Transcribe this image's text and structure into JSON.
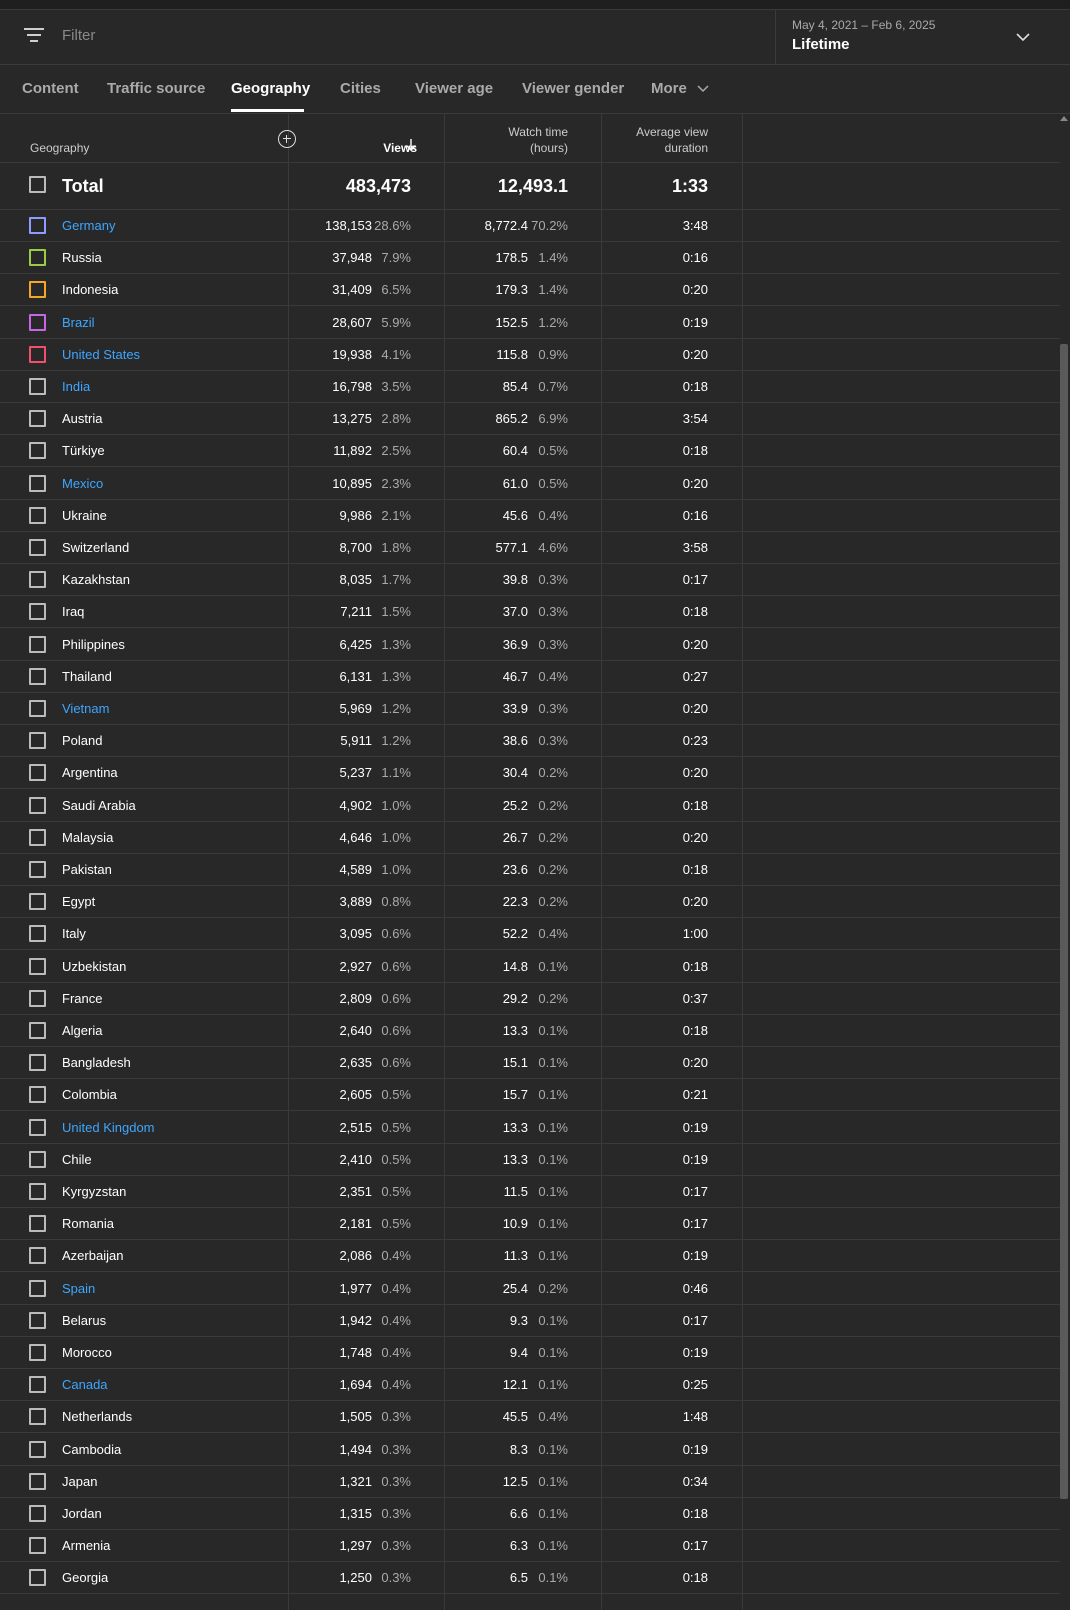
{
  "filter": {
    "placeholder": "Filter"
  },
  "date": {
    "range": "May 4, 2021 – Feb 6, 2025",
    "label": "Lifetime"
  },
  "tabs": [
    "Content",
    "Traffic source",
    "Geography",
    "Cities",
    "Viewer age",
    "Viewer gender",
    "More"
  ],
  "active_tab": "Geography",
  "table": {
    "headers": {
      "geography": "Geography",
      "views": "Views",
      "watch_time_1": "Watch time",
      "watch_time_2": "(hours)",
      "avd_1": "Average view",
      "avd_2": "duration"
    },
    "total": {
      "label": "Total",
      "views": "483,473",
      "watch": "12,493.1",
      "avd": "1:33"
    },
    "rows": [
      {
        "name": "Germany",
        "link": true,
        "swatch": "#8c9cff",
        "views": "138,153",
        "views_pct": "28.6%",
        "watch": "8,772.4",
        "watch_pct": "70.2%",
        "avd": "3:48"
      },
      {
        "name": "Russia",
        "link": false,
        "swatch": "#9ccc46",
        "views": "37,948",
        "views_pct": "7.9%",
        "watch": "178.5",
        "watch_pct": "1.4%",
        "avd": "0:16"
      },
      {
        "name": "Indonesia",
        "link": false,
        "swatch": "#f5a623",
        "views": "31,409",
        "views_pct": "6.5%",
        "watch": "179.3",
        "watch_pct": "1.4%",
        "avd": "0:20"
      },
      {
        "name": "Brazil",
        "link": true,
        "swatch": "#c666e5",
        "views": "28,607",
        "views_pct": "5.9%",
        "watch": "152.5",
        "watch_pct": "1.2%",
        "avd": "0:19"
      },
      {
        "name": "United States",
        "link": true,
        "swatch": "#f0506e",
        "views": "19,938",
        "views_pct": "4.1%",
        "watch": "115.8",
        "watch_pct": "0.9%",
        "avd": "0:20"
      },
      {
        "name": "India",
        "link": true,
        "swatch": "",
        "views": "16,798",
        "views_pct": "3.5%",
        "watch": "85.4",
        "watch_pct": "0.7%",
        "avd": "0:18"
      },
      {
        "name": "Austria",
        "link": false,
        "swatch": "",
        "views": "13,275",
        "views_pct": "2.8%",
        "watch": "865.2",
        "watch_pct": "6.9%",
        "avd": "3:54"
      },
      {
        "name": "Türkiye",
        "link": false,
        "swatch": "",
        "views": "11,892",
        "views_pct": "2.5%",
        "watch": "60.4",
        "watch_pct": "0.5%",
        "avd": "0:18"
      },
      {
        "name": "Mexico",
        "link": true,
        "swatch": "",
        "views": "10,895",
        "views_pct": "2.3%",
        "watch": "61.0",
        "watch_pct": "0.5%",
        "avd": "0:20"
      },
      {
        "name": "Ukraine",
        "link": false,
        "swatch": "",
        "views": "9,986",
        "views_pct": "2.1%",
        "watch": "45.6",
        "watch_pct": "0.4%",
        "avd": "0:16"
      },
      {
        "name": "Switzerland",
        "link": false,
        "swatch": "",
        "views": "8,700",
        "views_pct": "1.8%",
        "watch": "577.1",
        "watch_pct": "4.6%",
        "avd": "3:58"
      },
      {
        "name": "Kazakhstan",
        "link": false,
        "swatch": "",
        "views": "8,035",
        "views_pct": "1.7%",
        "watch": "39.8",
        "watch_pct": "0.3%",
        "avd": "0:17"
      },
      {
        "name": "Iraq",
        "link": false,
        "swatch": "",
        "views": "7,211",
        "views_pct": "1.5%",
        "watch": "37.0",
        "watch_pct": "0.3%",
        "avd": "0:18"
      },
      {
        "name": "Philippines",
        "link": false,
        "swatch": "",
        "views": "6,425",
        "views_pct": "1.3%",
        "watch": "36.9",
        "watch_pct": "0.3%",
        "avd": "0:20"
      },
      {
        "name": "Thailand",
        "link": false,
        "swatch": "",
        "views": "6,131",
        "views_pct": "1.3%",
        "watch": "46.7",
        "watch_pct": "0.4%",
        "avd": "0:27"
      },
      {
        "name": "Vietnam",
        "link": true,
        "swatch": "",
        "views": "5,969",
        "views_pct": "1.2%",
        "watch": "33.9",
        "watch_pct": "0.3%",
        "avd": "0:20"
      },
      {
        "name": "Poland",
        "link": false,
        "swatch": "",
        "views": "5,911",
        "views_pct": "1.2%",
        "watch": "38.6",
        "watch_pct": "0.3%",
        "avd": "0:23"
      },
      {
        "name": "Argentina",
        "link": false,
        "swatch": "",
        "views": "5,237",
        "views_pct": "1.1%",
        "watch": "30.4",
        "watch_pct": "0.2%",
        "avd": "0:20"
      },
      {
        "name": "Saudi Arabia",
        "link": false,
        "swatch": "",
        "views": "4,902",
        "views_pct": "1.0%",
        "watch": "25.2",
        "watch_pct": "0.2%",
        "avd": "0:18"
      },
      {
        "name": "Malaysia",
        "link": false,
        "swatch": "",
        "views": "4,646",
        "views_pct": "1.0%",
        "watch": "26.7",
        "watch_pct": "0.2%",
        "avd": "0:20"
      },
      {
        "name": "Pakistan",
        "link": false,
        "swatch": "",
        "views": "4,589",
        "views_pct": "1.0%",
        "watch": "23.6",
        "watch_pct": "0.2%",
        "avd": "0:18"
      },
      {
        "name": "Egypt",
        "link": false,
        "swatch": "",
        "views": "3,889",
        "views_pct": "0.8%",
        "watch": "22.3",
        "watch_pct": "0.2%",
        "avd": "0:20"
      },
      {
        "name": "Italy",
        "link": false,
        "swatch": "",
        "views": "3,095",
        "views_pct": "0.6%",
        "watch": "52.2",
        "watch_pct": "0.4%",
        "avd": "1:00"
      },
      {
        "name": "Uzbekistan",
        "link": false,
        "swatch": "",
        "views": "2,927",
        "views_pct": "0.6%",
        "watch": "14.8",
        "watch_pct": "0.1%",
        "avd": "0:18"
      },
      {
        "name": "France",
        "link": false,
        "swatch": "",
        "views": "2,809",
        "views_pct": "0.6%",
        "watch": "29.2",
        "watch_pct": "0.2%",
        "avd": "0:37"
      },
      {
        "name": "Algeria",
        "link": false,
        "swatch": "",
        "views": "2,640",
        "views_pct": "0.6%",
        "watch": "13.3",
        "watch_pct": "0.1%",
        "avd": "0:18"
      },
      {
        "name": "Bangladesh",
        "link": false,
        "swatch": "",
        "views": "2,635",
        "views_pct": "0.6%",
        "watch": "15.1",
        "watch_pct": "0.1%",
        "avd": "0:20"
      },
      {
        "name": "Colombia",
        "link": false,
        "swatch": "",
        "views": "2,605",
        "views_pct": "0.5%",
        "watch": "15.7",
        "watch_pct": "0.1%",
        "avd": "0:21"
      },
      {
        "name": "United Kingdom",
        "link": true,
        "swatch": "",
        "views": "2,515",
        "views_pct": "0.5%",
        "watch": "13.3",
        "watch_pct": "0.1%",
        "avd": "0:19"
      },
      {
        "name": "Chile",
        "link": false,
        "swatch": "",
        "views": "2,410",
        "views_pct": "0.5%",
        "watch": "13.3",
        "watch_pct": "0.1%",
        "avd": "0:19"
      },
      {
        "name": "Kyrgyzstan",
        "link": false,
        "swatch": "",
        "views": "2,351",
        "views_pct": "0.5%",
        "watch": "11.5",
        "watch_pct": "0.1%",
        "avd": "0:17"
      },
      {
        "name": "Romania",
        "link": false,
        "swatch": "",
        "views": "2,181",
        "views_pct": "0.5%",
        "watch": "10.9",
        "watch_pct": "0.1%",
        "avd": "0:17"
      },
      {
        "name": "Azerbaijan",
        "link": false,
        "swatch": "",
        "views": "2,086",
        "views_pct": "0.4%",
        "watch": "11.3",
        "watch_pct": "0.1%",
        "avd": "0:19"
      },
      {
        "name": "Spain",
        "link": true,
        "swatch": "",
        "views": "1,977",
        "views_pct": "0.4%",
        "watch": "25.4",
        "watch_pct": "0.2%",
        "avd": "0:46"
      },
      {
        "name": "Belarus",
        "link": false,
        "swatch": "",
        "views": "1,942",
        "views_pct": "0.4%",
        "watch": "9.3",
        "watch_pct": "0.1%",
        "avd": "0:17"
      },
      {
        "name": "Morocco",
        "link": false,
        "swatch": "",
        "views": "1,748",
        "views_pct": "0.4%",
        "watch": "9.4",
        "watch_pct": "0.1%",
        "avd": "0:19"
      },
      {
        "name": "Canada",
        "link": true,
        "swatch": "",
        "views": "1,694",
        "views_pct": "0.4%",
        "watch": "12.1",
        "watch_pct": "0.1%",
        "avd": "0:25"
      },
      {
        "name": "Netherlands",
        "link": false,
        "swatch": "",
        "views": "1,505",
        "views_pct": "0.3%",
        "watch": "45.5",
        "watch_pct": "0.4%",
        "avd": "1:48"
      },
      {
        "name": "Cambodia",
        "link": false,
        "swatch": "",
        "views": "1,494",
        "views_pct": "0.3%",
        "watch": "8.3",
        "watch_pct": "0.1%",
        "avd": "0:19"
      },
      {
        "name": "Japan",
        "link": false,
        "swatch": "",
        "views": "1,321",
        "views_pct": "0.3%",
        "watch": "12.5",
        "watch_pct": "0.1%",
        "avd": "0:34"
      },
      {
        "name": "Jordan",
        "link": false,
        "swatch": "",
        "views": "1,315",
        "views_pct": "0.3%",
        "watch": "6.6",
        "watch_pct": "0.1%",
        "avd": "0:18"
      },
      {
        "name": "Armenia",
        "link": false,
        "swatch": "",
        "views": "1,297",
        "views_pct": "0.3%",
        "watch": "6.3",
        "watch_pct": "0.1%",
        "avd": "0:17"
      },
      {
        "name": "Georgia",
        "link": false,
        "swatch": "",
        "views": "1,250",
        "views_pct": "0.3%",
        "watch": "6.5",
        "watch_pct": "0.1%",
        "avd": "0:18"
      }
    ]
  }
}
